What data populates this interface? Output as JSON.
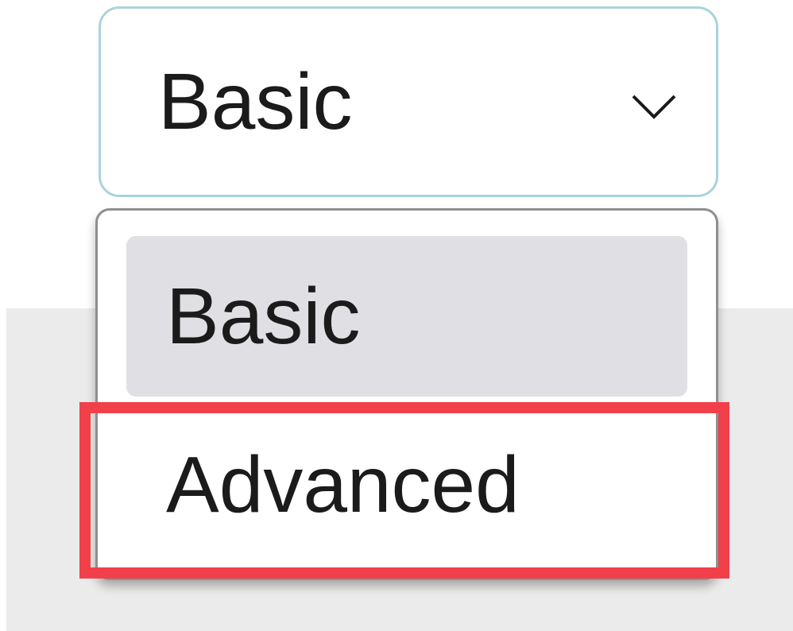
{
  "dropdown": {
    "selected_value": "Basic",
    "chevron_icon": "chevron-down-icon",
    "options": [
      {
        "label": "Basic",
        "state": "selected"
      },
      {
        "label": "Advanced",
        "state": "highlighted"
      }
    ]
  },
  "colors": {
    "select_border": "#a9d3dc",
    "selected_option_bg": "#e0dfe4",
    "highlight_frame": "#f2404a",
    "background_band": "#ebebeb"
  }
}
